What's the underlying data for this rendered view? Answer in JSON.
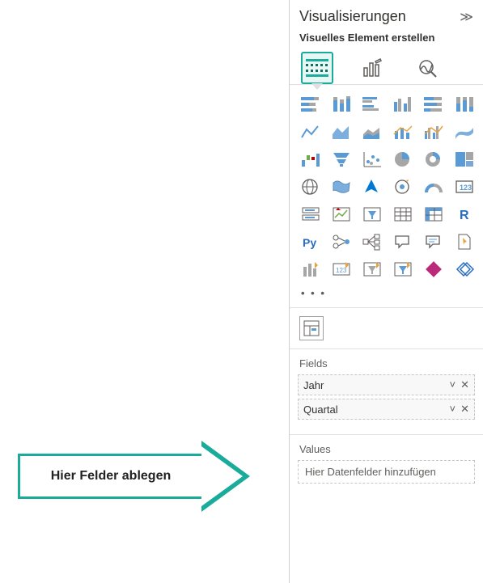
{
  "annotation": {
    "label": "Hier Felder ablegen"
  },
  "panel": {
    "title": "Visualisierungen",
    "subtitle": "Visuelles Element erstellen",
    "collapse_glyph": "≫",
    "more_glyph": "• • •"
  },
  "mode_tabs": [
    {
      "name": "build-visual-tab",
      "active": true
    },
    {
      "name": "format-visual-tab",
      "active": false
    },
    {
      "name": "analytics-tab",
      "active": false
    }
  ],
  "viz_icons": [
    "stacked-bar-chart",
    "stacked-column-chart",
    "clustered-bar-chart",
    "clustered-column-chart",
    "hundred-stacked-bar-chart",
    "hundred-stacked-column-chart",
    "line-chart",
    "area-chart",
    "stacked-area-chart",
    "line-stacked-column-chart",
    "line-clustered-column-chart",
    "ribbon-chart",
    "waterfall-chart",
    "funnel-chart",
    "scatter-chart",
    "pie-chart",
    "donut-chart",
    "treemap",
    "map",
    "filled-map",
    "azure-map",
    "arcgis-map",
    "gauge",
    "card",
    "multi-row-card",
    "kpi",
    "slicer",
    "table",
    "matrix",
    "r-visual",
    "python-visual",
    "key-influencers",
    "decomposition-tree",
    "qa-visual",
    "smart-narrative",
    "paginated-report",
    "power-apps",
    "power-automate",
    "ai-visual-1",
    "ai-visual-2",
    "app-source",
    "get-more-visuals"
  ],
  "wells": {
    "fields": {
      "label": "Fields",
      "items": [
        {
          "name": "Jahr"
        },
        {
          "name": "Quartal"
        }
      ]
    },
    "values": {
      "label": "Values",
      "placeholder": "Hier Datenfelder hinzufügen"
    }
  }
}
